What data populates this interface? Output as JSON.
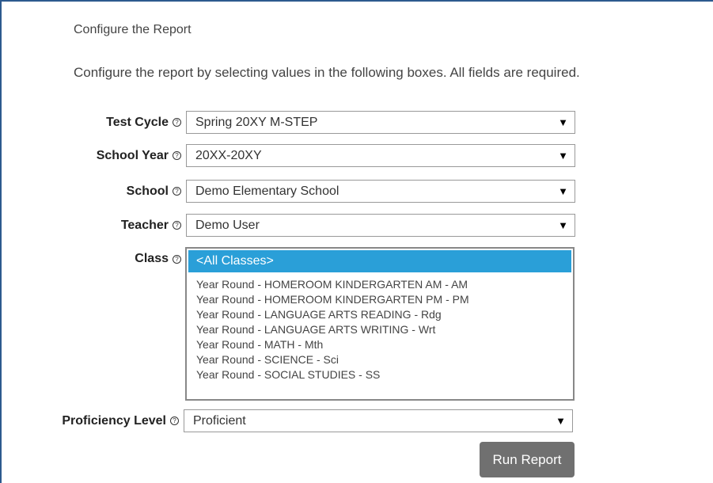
{
  "page": {
    "title": "Configure the Report",
    "instructions": "Configure the report by selecting values in the following boxes. All fields are required."
  },
  "fields": {
    "test_cycle": {
      "label": "Test Cycle",
      "value": "Spring 20XY M-STEP"
    },
    "school_year": {
      "label": "School Year",
      "value": "20XX-20XY"
    },
    "school": {
      "label": "School",
      "value": "Demo Elementary School"
    },
    "teacher": {
      "label": "Teacher",
      "value": "Demo User"
    },
    "class": {
      "label": "Class",
      "selected": "<All Classes>",
      "options": [
        "Year Round - HOMEROOM KINDERGARTEN AM - AM",
        "Year Round - HOMEROOM KINDERGARTEN PM - PM",
        "Year Round - LANGUAGE ARTS READING - Rdg",
        "Year Round -  LANGUAGE ARTS WRITING - Wrt",
        "Year Round - MATH - Mth",
        "Year Round - SCIENCE - Sci",
        "Year Round - SOCIAL STUDIES - SS"
      ]
    },
    "proficiency_level": {
      "label": "Proficiency Level",
      "value": "Proficient"
    }
  },
  "icons": {
    "help": "help-circle-icon",
    "dropdown": "triangle-down-icon"
  },
  "glyphs": {
    "help": "?",
    "dropdown": "▼"
  },
  "actions": {
    "run_report": "Run Report"
  },
  "colors": {
    "border_accent": "#2c5a8e",
    "selected_option": "#2a9fd8",
    "button": "#707070"
  }
}
